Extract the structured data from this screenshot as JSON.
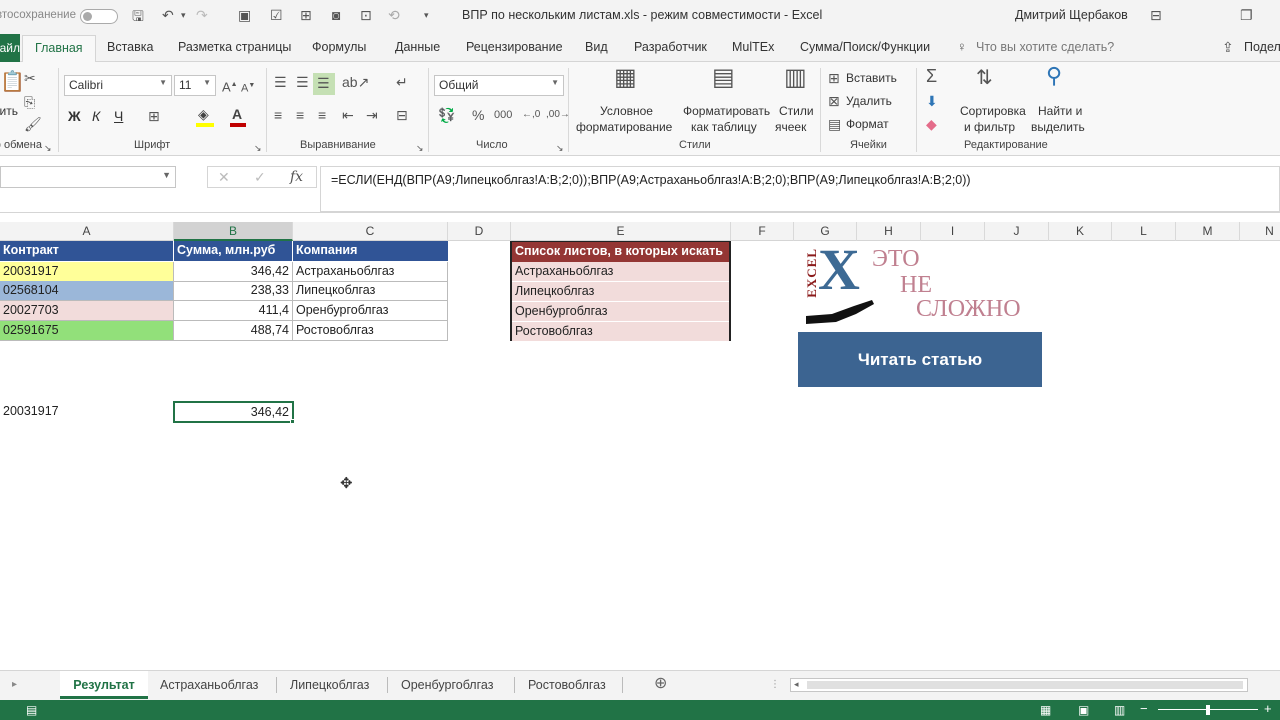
{
  "titlebar": {
    "autosave_label": "Автосохранение",
    "doc_title": "ВПР по нескольким листам.xls  -  режим совместимости  -  Excel",
    "user": "Дмитрий Щербаков"
  },
  "tabs": {
    "file": "Файл",
    "items": [
      "Главная",
      "Вставка",
      "Разметка страницы",
      "Формулы",
      "Данные",
      "Рецензирование",
      "Вид",
      "Разработчик",
      "MulTEx",
      "Сумма/Поиск/Функции"
    ],
    "tell_me": "Что вы хотите сделать?",
    "share": "Поделиться"
  },
  "ribbon": {
    "clipboard_label": "Буфер обмена",
    "paste_label": "Вставить",
    "font_name": "Calibri",
    "font_size": "11",
    "font_label": "Шрифт",
    "align_label": "Выравнивание",
    "number_format": "Общий",
    "number_label": "Число",
    "cond_format": [
      "Условное",
      "форматирование"
    ],
    "format_table": [
      "Форматировать",
      "как таблицу"
    ],
    "cell_styles": [
      "Стили",
      "ячеек"
    ],
    "styles_label": "Стили",
    "insert_label": "Вставить",
    "delete_label": "Удалить",
    "format_label": "Формат",
    "cells_label": "Ячейки",
    "sort_filter": [
      "Сортировка",
      "и фильтр"
    ],
    "find_select": [
      "Найти и",
      "выделить"
    ],
    "editing_label": "Редактирование"
  },
  "formula_bar": {
    "formula": "=ЕСЛИ(ЕНД(ВПР(A9;Липецкоблгаз!A:B;2;0));ВПР(A9;Астраханьоблгаз!A:B;2;0);ВПР(A9;Липецкоблгаз!A:B;2;0))"
  },
  "columns": [
    "A",
    "B",
    "C",
    "D",
    "E",
    "F",
    "G",
    "H",
    "I",
    "J",
    "K",
    "L",
    "M",
    "N"
  ],
  "table": {
    "headers": [
      "Контракт",
      "Сумма, млн.руб",
      "Компания"
    ],
    "rows": [
      {
        "contract": "20031917",
        "sum": "346,42",
        "company": "Астраханьоблгаз",
        "color": "#ffff99"
      },
      {
        "contract": "02568104",
        "sum": "238,33",
        "company": "Липецкоблгаз",
        "color": "#9bb7d9"
      },
      {
        "contract": "20027703",
        "sum": "411,4",
        "company": "Оренбургоблгаз",
        "color": "#f2dcdb"
      },
      {
        "contract": "02591675",
        "sum": "488,74",
        "company": "Ростовоблгаз",
        "color": "#92e07a"
      }
    ]
  },
  "lookup": {
    "contract": "20031917",
    "result": "346,42"
  },
  "sheet_list": {
    "header": "Список листов, в которых искать",
    "items": [
      "Астраханьоблгаз",
      "Липецкоблгаз",
      "Оренбургоблгаз",
      "Ростовоблгаз"
    ]
  },
  "logo": {
    "letter": "X",
    "side": "EXCEL",
    "w1": "ЭТО",
    "w2": "НЕ",
    "w3": "СЛОЖНО"
  },
  "read_button": "Читать статью",
  "sheets": [
    "Результат",
    "Астраханьоблгаз",
    "Липецкоблгаз",
    "Оренбургоблгаз",
    "Ростовоблгаз"
  ],
  "active_sheet": "Результат",
  "colors": {
    "excel_green": "#217346",
    "header_blue": "#305496",
    "list_header": "#943634",
    "list_fill": "#f2dcdb",
    "button_blue": "#3c6491"
  }
}
